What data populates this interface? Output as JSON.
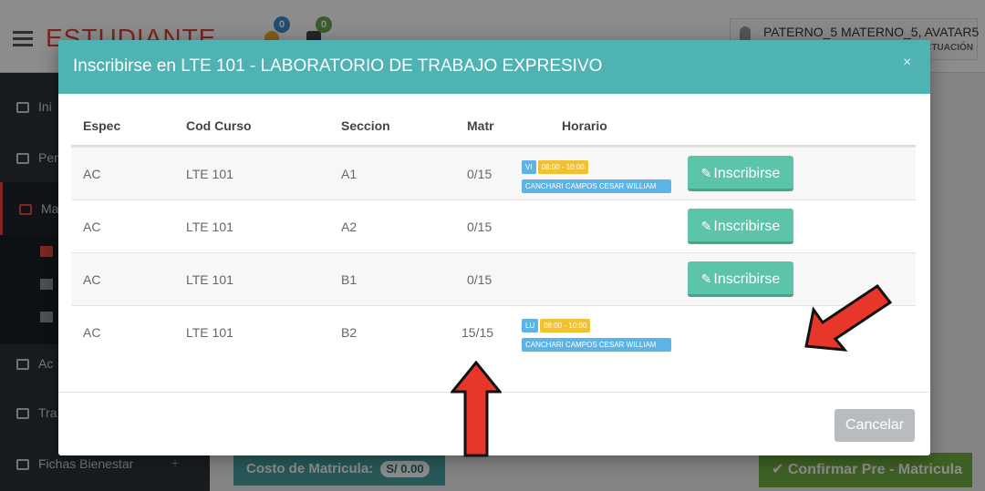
{
  "app": {
    "brand": "ESTUDIANTE",
    "notif_1_count": "0",
    "notif_2_count": "0",
    "user_name": "PATERNO_5 MATERNO_5, AVATAR5",
    "user_sub": "CTUACIÓN"
  },
  "sidebar": {
    "items": [
      {
        "label": "Ini"
      },
      {
        "label": "Per"
      },
      {
        "label": "Ma"
      },
      {
        "label": "Ac"
      },
      {
        "label": "Tra"
      },
      {
        "label": "Fichas Bienestar"
      }
    ],
    "plus": "+"
  },
  "background": {
    "cost_label": "Costo de Matricula:",
    "cost_value": "S/ 0.00",
    "confirm_label": "✔ Confirmar Pre - Matricula"
  },
  "modal": {
    "title": "Inscribirse en LTE 101 - LABORATORIO DE TRABAJO EXPRESIVO",
    "close": "×",
    "columns": {
      "espec": "Espec",
      "cod": "Cod Curso",
      "seccion": "Seccion",
      "matr": "Matr",
      "horario": "Horario"
    },
    "rows": [
      {
        "espec": "AC",
        "cod": "LTE 101",
        "seccion": "A1",
        "matr": "0/15",
        "day": "VI",
        "time": "08:00 - 10:00",
        "prof": "CANCHARI CAMPOS CESAR WILLIAM",
        "action": "Inscribirse"
      },
      {
        "espec": "AC",
        "cod": "LTE 101",
        "seccion": "A2",
        "matr": "0/15",
        "action": "Inscribirse"
      },
      {
        "espec": "AC",
        "cod": "LTE 101",
        "seccion": "B1",
        "matr": "0/15",
        "action": "Inscribirse"
      },
      {
        "espec": "AC",
        "cod": "LTE 101",
        "seccion": "B2",
        "matr": "15/15",
        "day": "LU",
        "time": "08:00 - 10:00",
        "prof": "CANCHARI CAMPOS CESAR WILLIAM"
      }
    ],
    "cancel_label": "Cancelar"
  },
  "colors": {
    "header": "#4fb2b3",
    "button": "#5bc4a9",
    "arrow": "#e8372a"
  },
  "icons": [
    "menu-icon",
    "bell-icon",
    "envelope-icon",
    "user-icon",
    "home-icon",
    "pencil-icon",
    "close-icon",
    "arrow-up-icon",
    "arrow-diagonal-icon"
  ]
}
